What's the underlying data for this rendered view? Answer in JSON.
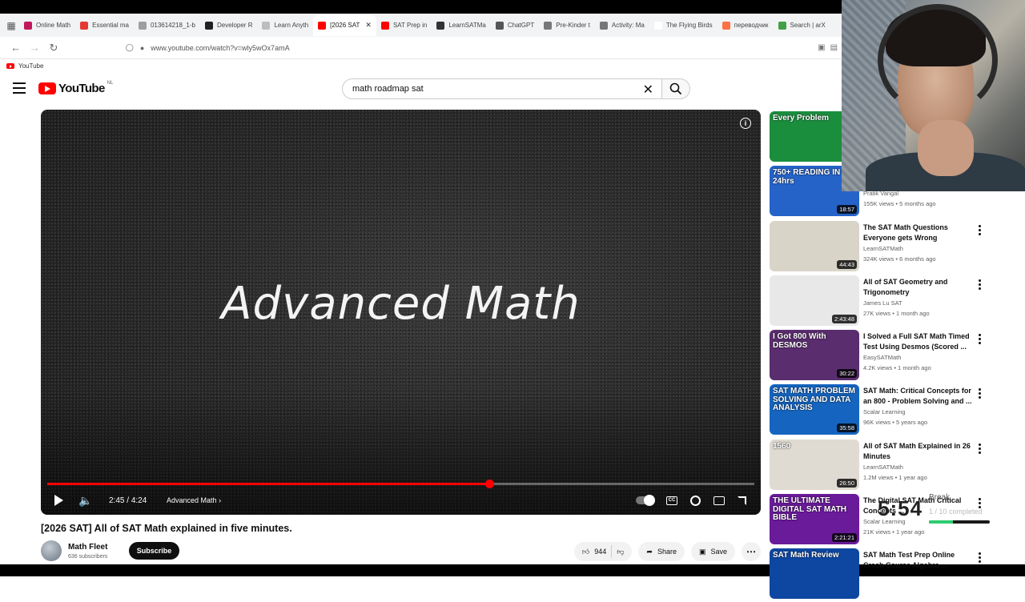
{
  "browser": {
    "tabs": [
      {
        "label": "Online Math",
        "color": "#c2185b"
      },
      {
        "label": "Essential ma",
        "color": "#e53935"
      },
      {
        "label": "013614218_1-b",
        "color": "#9e9e9e"
      },
      {
        "label": "Developer R",
        "color": "#212121"
      },
      {
        "label": "Learn Anyth",
        "color": "#bdbdbd"
      },
      {
        "label": "[2026 SAT",
        "color": "#ff0000",
        "active": true
      },
      {
        "label": "SAT Prep in",
        "color": "#ff0000"
      },
      {
        "label": "LearnSATMa",
        "color": "#333333"
      },
      {
        "label": "ChatGPT",
        "color": "#555555"
      },
      {
        "label": "Pre-Kinder t",
        "color": "#777777"
      },
      {
        "label": "Activity: Ma",
        "color": "#777777"
      },
      {
        "label": "The Flying Birds",
        "color": "#ffffff"
      },
      {
        "label": "переводчик",
        "color": "#ff7043"
      },
      {
        "label": "Search | arX",
        "color": "#43a047"
      }
    ],
    "url": "www.youtube.com/watch?v=wly5wOx7amA",
    "bookmark": "YouTube"
  },
  "youtube": {
    "logo_text": "YouTube",
    "country_code": "NL",
    "search_value": "math roadmap sat"
  },
  "player": {
    "overlay_text": "Advanced Math",
    "current_time": "2:45",
    "time_separator": " / ",
    "duration": "4:24",
    "progress_fraction": 0.625,
    "chapter": "Advanced Math",
    "cc_label": "CC"
  },
  "video": {
    "title": "[2026 SAT] All of SAT Math explained in five minutes.",
    "channel": "Math Fleet",
    "subscribers": "636 subscribers",
    "subscribe_label": "Subscribe",
    "likes": "944",
    "share_label": "Share",
    "save_label": "Save"
  },
  "recommendations": [
    {
      "title": "",
      "channel": "",
      "meta": "",
      "duration": "",
      "thumb_text": "Every Problem",
      "thumb_color": "#1b8e3e"
    },
    {
      "title": "",
      "channel": "Pratik Vangal",
      "meta": "155K views • 5 months ago",
      "duration": "18:57",
      "thumb_text": "750+ READING IN 24hrs",
      "thumb_color": "#2563c9"
    },
    {
      "title": "The SAT Math Questions Everyone gets Wrong",
      "channel": "LearnSATMath",
      "meta": "324K views • 6 months ago",
      "duration": "44:43",
      "thumb_text": "",
      "thumb_color": "#d9d4c8"
    },
    {
      "title": "All of SAT Geometry and Trigonometry",
      "channel": "James Lu SAT",
      "meta": "27K views • 1 month ago",
      "duration": "2:43:48",
      "thumb_text": "",
      "thumb_color": "#e8e8e8"
    },
    {
      "title": "I Solved a Full SAT Math Timed Test Using Desmos (Scored ...",
      "channel": "EasySATMath",
      "meta": "4.2K views • 1 month ago",
      "duration": "30:22",
      "thumb_text": "I Got 800 With DESMOS",
      "thumb_color": "#5a2d6f"
    },
    {
      "title": "SAT Math: Critical Concepts for an 800 - Problem Solving and ...",
      "channel": "Scalar Learning",
      "meta": "96K views • 5 years ago",
      "duration": "35:58",
      "thumb_text": "SAT MATH PROBLEM SOLVING AND DATA ANALYSIS",
      "thumb_color": "#1565c0"
    },
    {
      "title": "All of SAT Math Explained in 26 Minutes",
      "channel": "LearnSATMath",
      "meta": "1.2M views • 1 year ago",
      "duration": "26:50",
      "thumb_text": "1560",
      "thumb_color": "#e0dbd2"
    },
    {
      "title": "The Digital SAT Math Critical Concepts ...",
      "channel": "Scalar Learning",
      "meta": "21K views • 1 year ago",
      "duration": "2:21:21",
      "thumb_text": "THE ULTIMATE DIGITAL SAT MATH BIBLE",
      "thumb_color": "#6a1b9a"
    },
    {
      "title": "SAT Math Test Prep Online Crash Course Algebra ...",
      "channel": "",
      "meta": "",
      "duration": "",
      "thumb_text": "SAT Math Review",
      "thumb_color": "#0d47a1"
    }
  ],
  "timer_overlay": {
    "time": "5:54",
    "label": "Break",
    "progress_text": "1 / 10 completed",
    "progress_fraction": 0.4,
    "bar_color": "#2ecc71"
  }
}
